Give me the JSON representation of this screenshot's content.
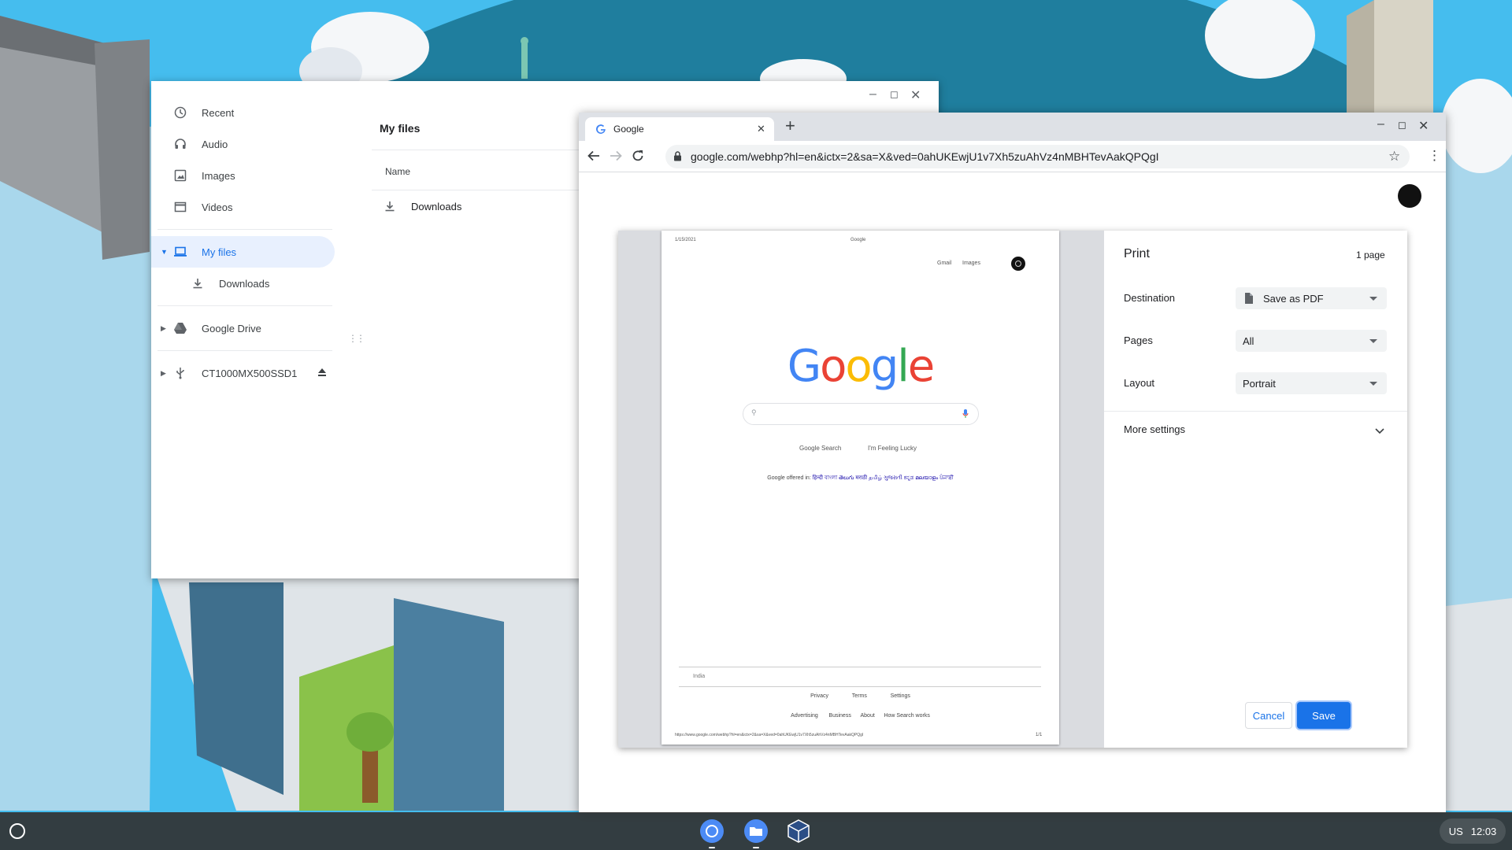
{
  "files": {
    "sidebar": [
      {
        "label": "Recent",
        "icon": "clock-icon"
      },
      {
        "label": "Audio",
        "icon": "headphones-icon"
      },
      {
        "label": "Images",
        "icon": "image-icon"
      },
      {
        "label": "Videos",
        "icon": "film-icon"
      },
      {
        "label": "My files",
        "icon": "laptop-icon",
        "active": true
      },
      {
        "label": "Downloads",
        "icon": "download-icon"
      },
      {
        "label": "Google Drive",
        "icon": "drive-icon"
      },
      {
        "label": "CT1000MX500SSD1",
        "icon": "usb-icon"
      }
    ],
    "title": "My files",
    "column_name": "Name",
    "rows": [
      {
        "name": "Downloads",
        "icon": "download-icon"
      }
    ]
  },
  "chrome": {
    "tab_title": "Google",
    "url": "google.com/webhp?hl=en&ictx=2&sa=X&ved=0ahUKEwjU1v7Xh5zuAhVz4nMBHTevAakQPQgI"
  },
  "print": {
    "title": "Print",
    "page_count": "1 page",
    "destination_label": "Destination",
    "destination_value": "Save as PDF",
    "pages_label": "Pages",
    "pages_value": "All",
    "layout_label": "Layout",
    "layout_value": "Portrait",
    "more_settings": "More settings",
    "cancel": "Cancel",
    "save": "Save"
  },
  "preview": {
    "date": "1/15/2021",
    "header_title": "Google",
    "gmail": "Gmail",
    "images": "Images",
    "logo_letters": [
      "G",
      "o",
      "o",
      "g",
      "l",
      "e"
    ],
    "search_button": "Google Search",
    "lucky_button": "I'm Feeling Lucky",
    "offered_in": "Google offered in:",
    "languages": [
      "हिन्दी",
      "বাংলা",
      "తెలుగు",
      "मराठी",
      "தமிழ்",
      "ગુજરાતી",
      "ಕನ್ನಡ",
      "മലയാളം",
      "ਪੰਜਾਬੀ"
    ],
    "country": "India",
    "footer_row1": [
      "Privacy",
      "Terms",
      "Settings"
    ],
    "footer_row2": [
      "Advertising",
      "Business",
      "About",
      "How Search works"
    ],
    "footer_url": "https://www.google.com/webhp?hl=en&ictx=2&sa=X&ved=0ahUKEwjU1v7Xh5zuAhVz4nMBHTevAakQPQgI",
    "page_num": "1/1"
  },
  "shelf": {
    "apps": [
      "chrome-icon",
      "files-icon",
      "virtualbox-icon"
    ],
    "locale": "US",
    "time": "12:03"
  },
  "colors": {
    "accent": "#1a73e8",
    "google_blue": "#4285f4",
    "google_red": "#ea4335",
    "google_yellow": "#fbbc05",
    "google_green": "#34a853"
  }
}
